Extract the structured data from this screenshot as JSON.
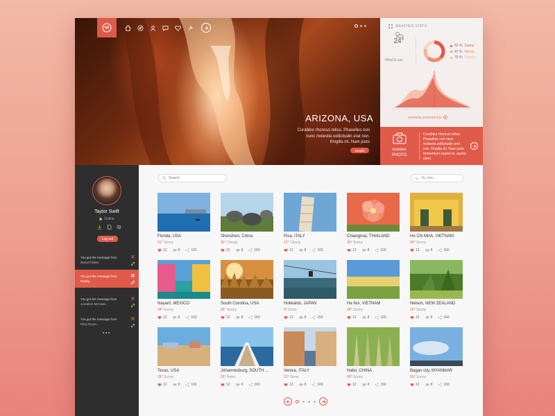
{
  "colors": {
    "accent": "#e05a4a",
    "sidebar_bg": "#2e2e2e",
    "status_online": "#9ec34a"
  },
  "hero": {
    "title": "ARIZONA, USA",
    "description": "Curabitur rhoncus tellus. Phasellus non nunc molestie.sollicitudin erat non. fringilla mi. Nam justo",
    "details_label": "Details",
    "nav_icons": [
      "home-icon",
      "compass-icon",
      "user-icon",
      "chat-icon",
      "heart-icon",
      "tools-icon",
      "arrow-right-icon"
    ]
  },
  "weather": {
    "header": "WEATHER STATS",
    "temperature": "24",
    "unit": "°",
    "subtitle": "Wind & sun",
    "legend": [
      {
        "percent": "52 %",
        "label": "Sunny",
        "color": "#e05a4a"
      },
      {
        "percent": "87 %",
        "label": "Windy",
        "color": "#f08a6a"
      },
      {
        "percent": "78 %",
        "label": "Cloudy",
        "color": "#f4b59a"
      }
    ],
    "visitor_label": "VISITOR STATISTICS"
  },
  "activities": {
    "label": "Activities",
    "title": "PHOTO",
    "text": "Curabitur rhoncus tellus. Phasellus non nunc molestie.sollicitudin erat non. fringilla mi. Nam justo fermentum sapien in. auctor elem."
  },
  "user": {
    "name": "Taylor Swift",
    "status": "Online",
    "logout_label": "Log out"
  },
  "messages": [
    {
      "text": "You got the message from",
      "sender": "Darryl Parker.",
      "active": false
    },
    {
      "text": "You got the message from",
      "sender": "Daddy.",
      "active": true
    },
    {
      "text": "You got the message from",
      "sender": "Jonathon McCabe..",
      "active": false
    },
    {
      "text": "You got the message from",
      "sender": "Riley Bryan..",
      "active": false
    }
  ],
  "search": {
    "placeholder": "Search"
  },
  "sort": {
    "label": "By date"
  },
  "photos": [
    {
      "name": "Florida, USA",
      "temp": "31",
      "weather": "Sunny",
      "likes": "12",
      "comments": "8",
      "shares": "160",
      "scene": "sea"
    },
    {
      "name": "Shenzhen, China",
      "temp": "26",
      "weather": "Cloudy",
      "likes": "12",
      "comments": "8",
      "shares": "160",
      "scene": "stones"
    },
    {
      "name": "Pisa, ITALY",
      "temp": "22",
      "weather": "Cloudy",
      "likes": "12",
      "comments": "8",
      "shares": "160",
      "scene": "tower"
    },
    {
      "name": "Chiangmai, THAILAND",
      "temp": "30",
      "weather": "Sunny",
      "likes": "12",
      "comments": "8",
      "shares": "160",
      "scene": "flower"
    },
    {
      "name": "Ho Chi Minh, VIETNAM",
      "temp": "29",
      "weather": "Sunny",
      "likes": "12",
      "comments": "8",
      "shares": "160",
      "scene": "house"
    },
    {
      "name": "Nayarit, MEXICO",
      "temp": "34",
      "weather": "Sunny",
      "likes": "12",
      "comments": "8",
      "shares": "160",
      "scene": "canal"
    },
    {
      "name": "South Corolina, USA",
      "temp": "26",
      "weather": "Sunny",
      "likes": "12",
      "comments": "8",
      "shares": "160",
      "scene": "grass"
    },
    {
      "name": "Hokkaido, JAPAN",
      "temp": "4",
      "weather": "Snow",
      "likes": "12",
      "comments": "8",
      "shares": "160",
      "scene": "cable"
    },
    {
      "name": "Ha Noi, VIETNAM",
      "temp": "28",
      "weather": "Sunny",
      "likes": "12",
      "comments": "8",
      "shares": "160",
      "scene": "field"
    },
    {
      "name": "Nelson, NEW ZEALAND",
      "temp": "29",
      "weather": "Sunny",
      "likes": "12",
      "comments": "8",
      "shares": "160",
      "scene": "forest"
    },
    {
      "name": "Texas, USA",
      "temp": "29",
      "weather": "Sunny",
      "likes": "12",
      "comments": "8",
      "shares": "160",
      "scene": "beach"
    },
    {
      "name": "Johannesburg, SOUTH ...",
      "temp": "25",
      "weather": "Rainy",
      "likes": "12",
      "comments": "8",
      "shares": "160",
      "scene": "pier"
    },
    {
      "name": "Venice, ITALY",
      "temp": "31",
      "weather": "Snow",
      "likes": "12",
      "comments": "8",
      "shares": "160",
      "scene": "street"
    },
    {
      "name": "Hafei, CHINA",
      "temp": "28",
      "weather": "Sunny",
      "likes": "12",
      "comments": "8",
      "shares": "160",
      "scene": "wheat"
    },
    {
      "name": "Bagan city, MYANMAR",
      "temp": "29",
      "weather": "Sunny",
      "likes": "12",
      "comments": "8",
      "shares": "160",
      "scene": "sky"
    }
  ]
}
